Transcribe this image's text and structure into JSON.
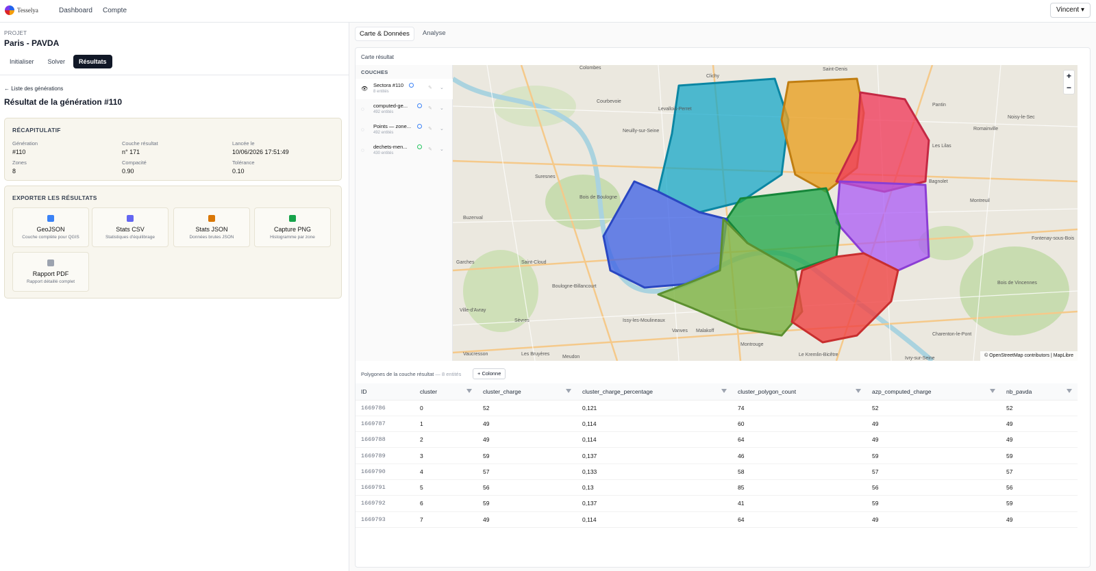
{
  "app": {
    "name": "Tesselya",
    "nav": [
      "Dashboard",
      "Compte"
    ],
    "user": "Vincent ▾"
  },
  "project": {
    "label": "PROJET",
    "name": "Paris - PAVDA",
    "tabs": [
      "Initialiser",
      "Solver",
      "Résultats"
    ],
    "active_tab": "Résultats"
  },
  "generation": {
    "back": "← Liste des générations",
    "title": "Résultat de la génération #110"
  },
  "recap": {
    "title": "RÉCAPITULATIF",
    "fields": [
      {
        "k": "Génération",
        "v": "#110"
      },
      {
        "k": "Couche résultat",
        "v": "n° 171"
      },
      {
        "k": "Lancée le",
        "v": "10/06/2026 17:51:49"
      },
      {
        "k": "Zones",
        "v": "8"
      },
      {
        "k": "Compacité",
        "v": "0.90"
      },
      {
        "k": "Tolérance",
        "v": "0.10"
      }
    ]
  },
  "export": {
    "title": "EXPORTER LES RÉSULTATS",
    "items": [
      {
        "t": "GeoJSON",
        "s": "Couche complète pour QGIS",
        "icon": "map-icon",
        "color": "#3b82f6"
      },
      {
        "t": "Stats CSV",
        "s": "Statistiques d'équilibrage",
        "icon": "bar-chart-icon",
        "color": "#6366f1"
      },
      {
        "t": "Stats JSON",
        "s": "Données brutes JSON",
        "icon": "clipboard-icon",
        "color": "#d97706"
      },
      {
        "t": "Capture PNG",
        "s": "Histogramme par zone",
        "icon": "image-icon",
        "color": "#16a34a"
      },
      {
        "t": "Rapport PDF",
        "s": "Rapport détaillé complet",
        "icon": "document-icon",
        "color": "#9ca3af"
      }
    ]
  },
  "right_tabs": [
    "Carte & Données",
    "Analyse"
  ],
  "map": {
    "title": "Carte résultat",
    "layers_title": "COUCHES",
    "layers": [
      {
        "name": "Sectora #110",
        "count": "8 entités",
        "visible": true,
        "dot": "#3b82f6"
      },
      {
        "name": "computed-ge...",
        "count": "492 entités",
        "visible": false,
        "dot": "#3b82f6"
      },
      {
        "name": "Points — zone...",
        "count": "492 entités",
        "visible": false,
        "dot": "#3b82f6"
      },
      {
        "name": "dechets-men...",
        "count": "430 entités",
        "visible": false,
        "dot": "#22c55e"
      }
    ],
    "attribution": "© OpenStreetMap contributors | MapLibre",
    "place_labels": [
      "Colombes",
      "Courbevoie",
      "Levallois-Perret",
      "Neuilly-sur-Seine",
      "Suresnes",
      "Bois de Boulogne",
      "Garches",
      "Boulogne-Billancourt",
      "Saint-Cloud",
      "Ville-d'Avray",
      "Sèvres",
      "Issy-les-Moulineaux",
      "Vanves",
      "Malakoff",
      "Montrouge",
      "Clichy",
      "Saint-Denis",
      "Pantin",
      "Les Lilas",
      "Romainville",
      "Bagnolet",
      "Montreuil",
      "Noisy-le-Sec",
      "Fontenay-sous-Bois",
      "Bois de Vincennes",
      "Charenton-le-Pont",
      "Ivry-sur-Seine",
      "Le Kremlin-Bicêtre",
      "Meudon",
      "Les Bruyères",
      "Vaucresson",
      "Buzenval"
    ],
    "zone_colors": [
      "#3b82f6",
      "#0ea5c7",
      "#e9a023",
      "#ef3b5b",
      "#a855f7",
      "#22a84a",
      "#7cb342",
      "#ef4444"
    ]
  },
  "table": {
    "caption": "Polygones de la couche résultat",
    "count": "— 8 entités",
    "add_col": "+ Colonne",
    "columns": [
      "ID",
      "cluster",
      "cluster_charge",
      "cluster_charge_percentage",
      "cluster_polygon_count",
      "azp_computed_charge",
      "nb_pavda"
    ],
    "rows": [
      [
        "1669786",
        "0",
        "52",
        "0,121",
        "74",
        "52",
        "52"
      ],
      [
        "1669787",
        "1",
        "49",
        "0,114",
        "60",
        "49",
        "49"
      ],
      [
        "1669788",
        "2",
        "49",
        "0,114",
        "64",
        "49",
        "49"
      ],
      [
        "1669789",
        "3",
        "59",
        "0,137",
        "46",
        "59",
        "59"
      ],
      [
        "1669790",
        "4",
        "57",
        "0,133",
        "58",
        "57",
        "57"
      ],
      [
        "1669791",
        "5",
        "56",
        "0,13",
        "85",
        "56",
        "56"
      ],
      [
        "1669792",
        "6",
        "59",
        "0,137",
        "41",
        "59",
        "59"
      ],
      [
        "1669793",
        "7",
        "49",
        "0,114",
        "64",
        "49",
        "49"
      ]
    ]
  }
}
